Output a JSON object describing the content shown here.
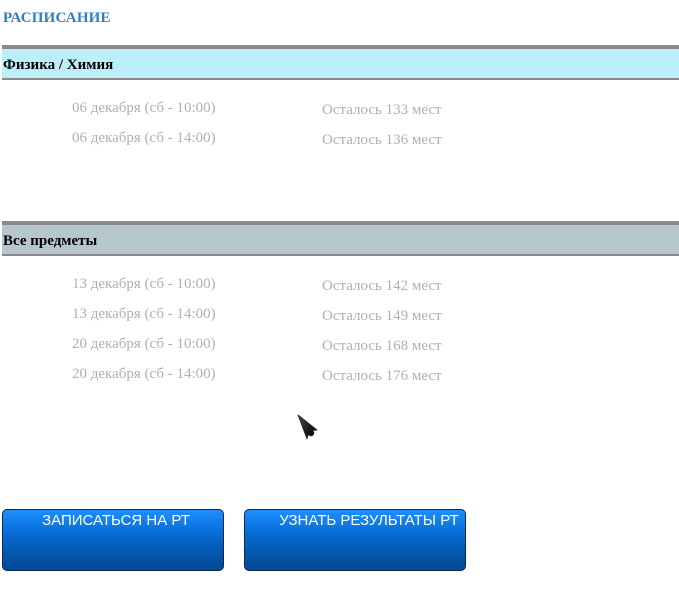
{
  "page": {
    "title": "РАСПИСАНИЕ"
  },
  "sections": [
    {
      "title": "Физика / Химия",
      "slots": [
        {
          "date": "06 декабря (сб - 10:00)",
          "seats": "Осталось 133 мест"
        },
        {
          "date": "06 декабря (сб - 14:00)",
          "seats": "Осталось 136 мест"
        }
      ]
    },
    {
      "title": "Все предметы",
      "slots": [
        {
          "date": "13 декабря (сб - 10:00)",
          "seats": "Осталось 142 мест"
        },
        {
          "date": "13 декабря (сб - 14:00)",
          "seats": "Осталось 149 мест"
        },
        {
          "date": "20 декабря (сб - 10:00)",
          "seats": "Осталось 168 мест"
        },
        {
          "date": "20 декабря (сб - 14:00)",
          "seats": "Осталось 176 мест"
        }
      ]
    }
  ],
  "buttons": {
    "register_label": "ЗАПИСАТЬСЯ НА РТ",
    "results_label": "УЗНАТЬ РЕЗУЛЬТАТЫ РТ"
  },
  "colors": {
    "title": "#2e7fbf",
    "section1_header": "#bdeffb",
    "section2_header": "#b6c6cc",
    "slot_text": "#b0b0b0",
    "button_top": "#1d8fff",
    "button_bottom": "#034a94"
  },
  "icons": {
    "cursor": "mouse-pointer-icon"
  }
}
